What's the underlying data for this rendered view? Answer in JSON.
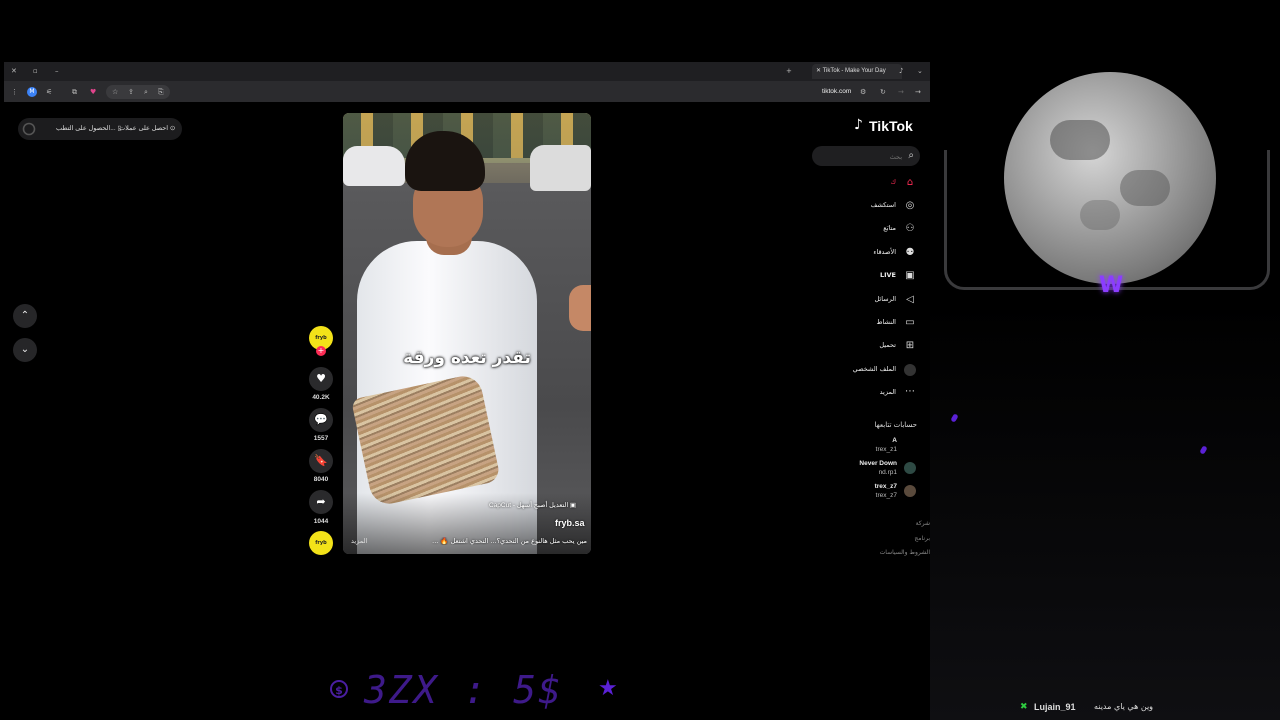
{
  "browser": {
    "tab_title": "TikTok - Make Your Day",
    "url": "tiktok.com",
    "profile_initial": "M"
  },
  "promo": {
    "get_coins": "احصل على عملات",
    "get_app": "الحصول على التطب..."
  },
  "video": {
    "caption_overlay": "تقدر تعده ورقة",
    "capcut_tag": "CapCut - التعديل أصبح أسهل",
    "author": "fryb.sa",
    "description": "مين يحب مثل هالنوع من التحدي؟... التحدي اشتعل 🔥 ...",
    "more": "المزيد"
  },
  "actions": {
    "likes": "40.2K",
    "comments": "1557",
    "bookmarks": "8040",
    "shares": "1044"
  },
  "sidebar": {
    "logo": "TikTok",
    "search_placeholder": "بحث",
    "nav": [
      {
        "label": "ك",
        "icon": "home-icon"
      },
      {
        "label": "استكشف",
        "icon": "explore-icon"
      },
      {
        "label": "متابَع",
        "icon": "following-icon"
      },
      {
        "label": "الأصدقاء",
        "icon": "friends-icon"
      },
      {
        "label": "LIVE",
        "icon": "live-icon"
      },
      {
        "label": "الرسائل",
        "icon": "messages-icon"
      },
      {
        "label": "النشاط",
        "icon": "activity-icon"
      },
      {
        "label": "تحميل",
        "icon": "upload-icon"
      },
      {
        "label": "الملف الشخصي",
        "icon": "profile-icon"
      },
      {
        "label": "المزيد",
        "icon": "more-icon"
      }
    ],
    "following_title": "حسابات تتابعها",
    "following": [
      {
        "name": "A",
        "handle": "trex_z1"
      },
      {
        "name": "Never Down",
        "handle": "nd.rp1"
      },
      {
        "name": "trex_z7",
        "handle": "trex_z7"
      }
    ],
    "footer": [
      "شركة",
      "برنامج",
      "الشروط والسياسات"
    ]
  },
  "overlay": {
    "badge": "W",
    "banner_text": "3ZX : 5$",
    "chat_user": "Lujain_91",
    "chat_message": "وين هي ياي مدينه"
  },
  "colors": {
    "accent": "#fe2c55",
    "stream_purple": "#5b21d6"
  }
}
